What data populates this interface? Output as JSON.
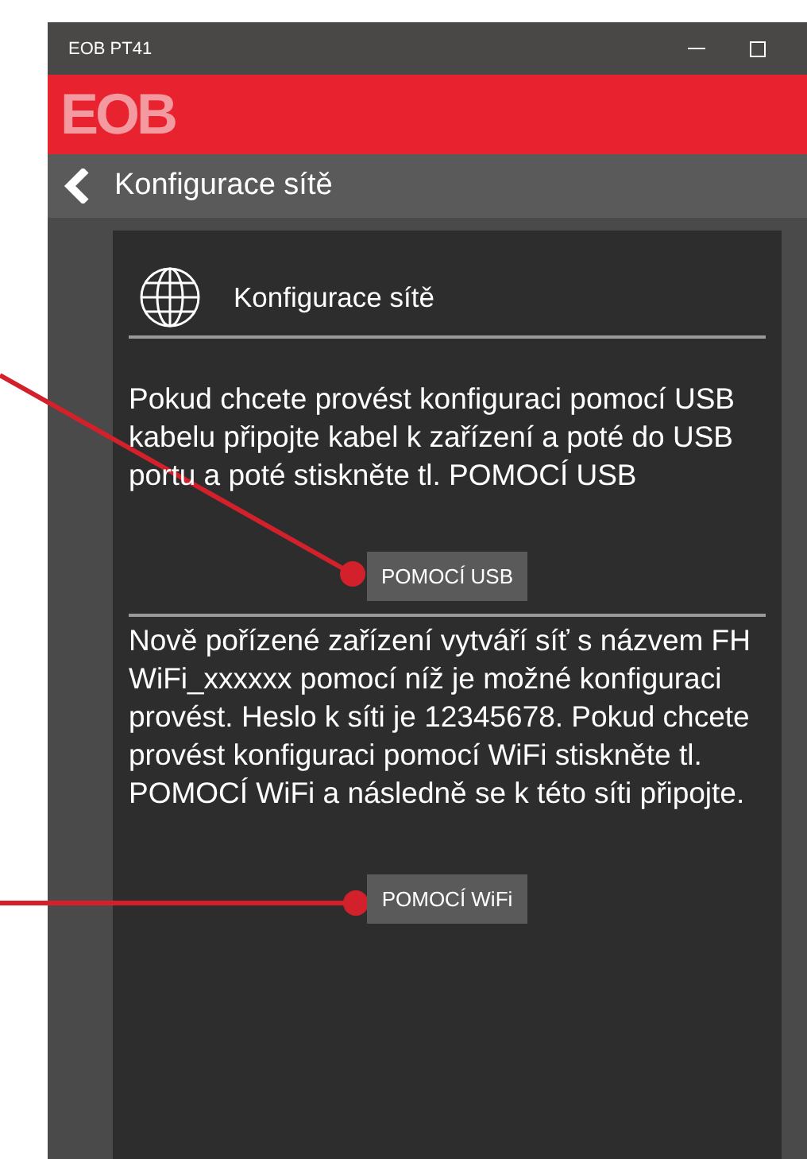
{
  "window": {
    "title": "EOB PT41"
  },
  "logo": {
    "text": "EOB"
  },
  "nav": {
    "title": "Konfigurace sítě"
  },
  "card": {
    "title": "Konfigurace sítě",
    "sections": [
      {
        "text": "Pokud chcete provést konfiguraci pomocí USB kabelu připojte kabel k zařízení a poté do USB portu a poté stiskněte tl. POMOCÍ USB",
        "button": "POMOCÍ USB"
      },
      {
        "text": "Nově pořízené zařízení vytváří síť s názvem FH WiFi_xxxxxx pomocí níž je možné konfiguraci provést. Heslo k síti je 12345678. Pokud chcete provést konfiguraci pomocí  WiFi stiskněte tl. POMOCÍ WiFi a následně se k této síti připojte.",
        "button": "POMOCÍ WiFi"
      }
    ]
  }
}
